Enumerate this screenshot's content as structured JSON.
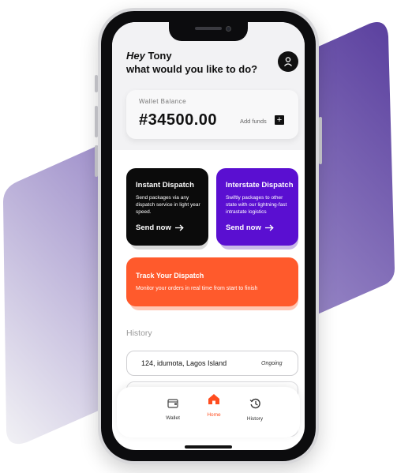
{
  "colors": {
    "accent_orange": "#ff5a2c",
    "purple": "#5a0fd1",
    "black_card": "#0b0b0b",
    "bg_gradient_start": "#f2f2f5",
    "bg_gradient_end": "#5a3f9e"
  },
  "header": {
    "hey": "Hey",
    "name": "Tony",
    "prompt": "what would you like to do?",
    "avatar_icon": "user-icon"
  },
  "wallet": {
    "label": "Wallet Balance",
    "amount": "#34500.00",
    "add_funds_label": "Add funds",
    "add_icon": "plus-icon"
  },
  "cards": {
    "instant": {
      "title": "Instant Dispatch",
      "description": "Send packages via any dispatch service in light year speed.",
      "action": "Send now"
    },
    "interstate": {
      "title": "Interstate Dispatch",
      "description": "Swiftly packages to other state with our lightning-fast intrastate logistics",
      "action": "Send now"
    },
    "track": {
      "title": "Track Your Dispatch",
      "description": "Monitor your orders in real time from start to finish"
    }
  },
  "history": {
    "title": "History",
    "items": [
      {
        "address": "124, idumota, Lagos Island",
        "status": "Ongoing"
      }
    ]
  },
  "nav": {
    "wallet": "Wallet",
    "home": "Home",
    "history": "History"
  }
}
